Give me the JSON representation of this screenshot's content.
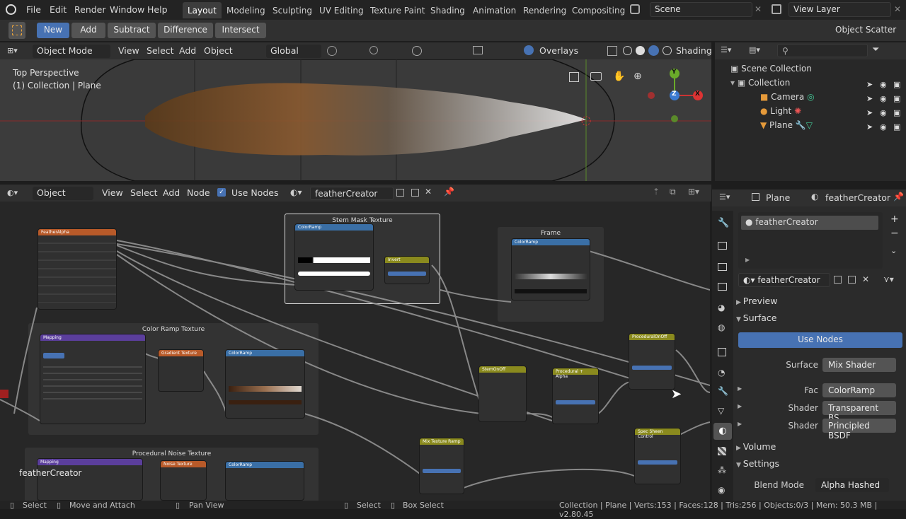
{
  "menus": [
    "File",
    "Edit",
    "Render",
    "Window",
    "Help"
  ],
  "workspaces": [
    "Layout",
    "Modeling",
    "Sculpting",
    "UV Editing",
    "Texture Paint",
    "Shading",
    "Animation",
    "Rendering",
    "Compositing"
  ],
  "active_workspace": "Layout",
  "scene_name": "Scene",
  "view_layer": "View Layer",
  "tool_modes": [
    "New",
    "Add",
    "Subtract",
    "Difference",
    "Intersect"
  ],
  "object_scatter": "Object Scatter",
  "viewport_header": {
    "mode": "Object Mode",
    "view": "View",
    "select": "Select",
    "add": "Add",
    "object": "Object",
    "orientation": "Global",
    "overlays": "Overlays",
    "shading": "Shading"
  },
  "viewport": {
    "perspective": "Top Perspective",
    "collection": "(1) Collection | Plane"
  },
  "outliner": {
    "root": "Scene Collection",
    "collection": "Collection",
    "items": [
      "Camera",
      "Light",
      "Plane"
    ]
  },
  "node_header": {
    "type": "Object",
    "view": "View",
    "select": "Select",
    "add": "Add",
    "node": "Node",
    "use_nodes": "Use Nodes",
    "material": "featherCreator"
  },
  "node_editor": {
    "frames": [
      "Stem Mask Texture",
      "Frame",
      "Color Ramp Texture",
      "Procedural Noise Texture"
    ],
    "nodes": [
      "FeatherAlpha",
      "ColorRamp",
      "Invert",
      "Mapping",
      "Gradient Texture",
      "StemOnOff",
      "Procedural + Alpha",
      "ProceduralOnOff",
      "Mix Texture Ramp",
      "Spec Sheen Control",
      "Noise Texture"
    ],
    "material_label": "featherCreator"
  },
  "props": {
    "object": "Plane",
    "material": "featherCreator",
    "slot": "featherCreator",
    "panels": [
      "Preview",
      "Surface",
      "Volume",
      "Settings"
    ],
    "use_nodes": "Use Nodes",
    "rows": [
      {
        "label": "Surface",
        "value": "Mix Shader"
      },
      {
        "label": "Fac",
        "value": "ColorRamp"
      },
      {
        "label": "Shader",
        "value": "Transparent BS.."
      },
      {
        "label": "Shader",
        "value": "Principled BSDF"
      }
    ],
    "blend_mode": {
      "label": "Blend Mode",
      "value": "Alpha Hashed"
    }
  },
  "status": {
    "left": [
      "Select",
      "Move and Attach",
      "Pan View",
      "Select",
      "Box Select"
    ],
    "right": "Collection | Plane | Verts:153 | Faces:128 | Tris:256 | Objects:0/3 | Mem: 50.3 MB | v2.80.45"
  },
  "colors": {
    "accent": "#4772b3",
    "attribute_node": "#b85a29",
    "input_node": "#3a6fa6",
    "vector_node": "#5b3e9c",
    "converter_node": "#8a8a1e"
  }
}
